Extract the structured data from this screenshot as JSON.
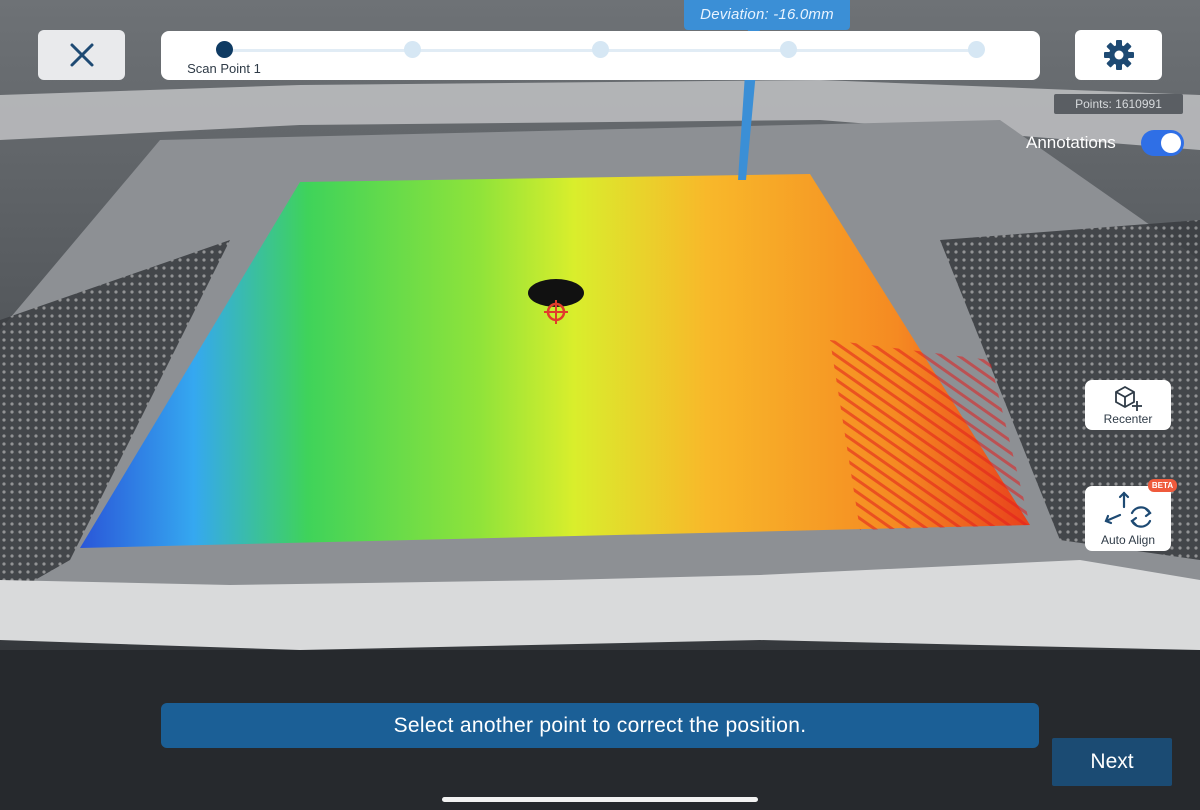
{
  "deviation": {
    "text": "Deviation: -16.0mm"
  },
  "toolbar": {
    "close_icon": "close-icon",
    "settings_icon": "gear-icon"
  },
  "stepper": {
    "steps": [
      {
        "label": "Scan Point 1",
        "active": true
      },
      {
        "label": "",
        "active": false
      },
      {
        "label": "",
        "active": false
      },
      {
        "label": "",
        "active": false
      },
      {
        "label": "",
        "active": false
      }
    ]
  },
  "points": {
    "text": "Points: 1610991"
  },
  "annotations": {
    "label": "Annotations",
    "enabled": true
  },
  "recenter": {
    "label": "Recenter",
    "icon": "cube-recenter-icon"
  },
  "auto_align": {
    "label": "Auto Align",
    "badge": "BETA",
    "icon": "auto-align-icon"
  },
  "banner": {
    "message": "Select another point to correct the position."
  },
  "next": {
    "label": "Next"
  },
  "colors": {
    "banner_bg": "#1b5f96",
    "next_bg": "#1b4b73",
    "toggle_on": "#2f6fe6",
    "step_active": "#0f3b63",
    "beta_badge": "#ef5a3c"
  }
}
